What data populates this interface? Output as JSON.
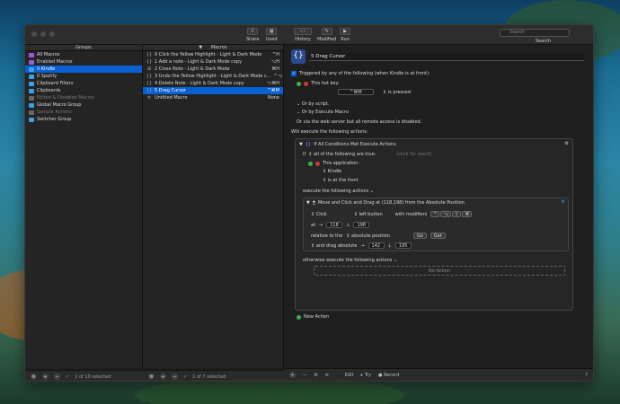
{
  "toolbar": {
    "share": "Share",
    "used": "Used",
    "history": "History",
    "modified": "Modified",
    "run": "Run",
    "search_placeholder": "Search",
    "search_label": "Search"
  },
  "groups": {
    "header": "Groups",
    "items": [
      {
        "label": "All Macros",
        "color": "#9b59e0",
        "state": "normal"
      },
      {
        "label": "Enabled Macros",
        "color": "#9b59e0",
        "state": "normal"
      },
      {
        "label": "0 Kindle",
        "color": "#3aa0e8",
        "state": "selected"
      },
      {
        "label": "0 Spotify",
        "color": "#3aa0e8",
        "state": "normal"
      },
      {
        "label": "Clipboard Filters",
        "color": "#3aa0e8",
        "state": "normal"
      },
      {
        "label": "Clipboards",
        "color": "#3aa0e8",
        "state": "normal"
      },
      {
        "label": "Edited & Disabled Macros",
        "color": "#666666",
        "state": "dim"
      },
      {
        "label": "Global Macro Group",
        "color": "#3aa0e8",
        "state": "normal"
      },
      {
        "label": "Sample Actions",
        "color": "#666666",
        "state": "dim"
      },
      {
        "label": "Switcher Group",
        "color": "#3aa0e8",
        "state": "normal"
      }
    ],
    "footer_count": "1 of 10 selected"
  },
  "macros": {
    "header": "Macros",
    "items": [
      {
        "label": "0 Click the Yellow Highlight - Light & Dark Mode",
        "hotkey": "^H",
        "icon": "{}",
        "state": "normal"
      },
      {
        "label": "1 Add a note - Light & Dark Mode copy",
        "hotkey": "⌥H",
        "icon": "{}",
        "state": "normal"
      },
      {
        "label": "2 Close Note - Light & Dark Mode",
        "hotkey": "⌘H",
        "icon": "⊞",
        "state": "normal"
      },
      {
        "label": "3 Undo the Yellow Highlight - Light & Dark Mode c...",
        "hotkey": "^⌥⇧⌘H",
        "icon": "{}",
        "state": "normal"
      },
      {
        "label": "4 Delete Note - Light & Dark Mode copy",
        "hotkey": "⌥⌘H",
        "icon": "{}",
        "state": "normal"
      },
      {
        "label": "5 Drag Cursor",
        "hotkey": "^⌘M",
        "icon": "{}",
        "state": "selected"
      },
      {
        "label": "Untitled Macro",
        "hotkey": "None",
        "icon": "✲",
        "state": "normal"
      }
    ],
    "footer_count": "1 of 7 selected"
  },
  "editor": {
    "macro_name": "5 Drag Cursor",
    "trigger_heading": "Triggered by any of the following (when Kindle is at front):",
    "hotkey_label": "This hot key:",
    "hotkey_value": "^⌘M",
    "hotkey_mode": "is pressed",
    "or_by_script": "Or by script.",
    "or_by_execute": "Or by Execute Macro",
    "web_server_note": "Or via the web server but all remote access is disabled.",
    "will_execute": "Will execute the following actions:",
    "if_action": {
      "title": "If All Conditions Met Execute Actions",
      "cond_prefix": "If",
      "cond_all": "all of the following are true:",
      "click_hint": "(click for result)",
      "cond_app": "This application:",
      "app_name": "Kindle",
      "app_state": "is at the front",
      "then_label": "execute the following actions",
      "inner_action": {
        "title": "Move and Click and Drag at (118,198) from the Absolute Position",
        "click": "Click",
        "button": "left button",
        "modifiers_label": "with modifiers",
        "modifiers": [
          "^",
          "⌥",
          "⇧",
          "⌘"
        ],
        "at_label": "at",
        "x": "118",
        "y": "198",
        "relative_label": "relative to the",
        "relative_value": "absolute position",
        "go": "Go",
        "get": "Get",
        "drag_label": "and drag absolute",
        "drag_x": "142",
        "drag_y": "195"
      },
      "else_label": "otherwise execute the following actions",
      "no_action": "No Action"
    },
    "new_action": "New Action"
  },
  "editor_footer": {
    "edit": "Edit",
    "try": "Try",
    "record": "Record"
  }
}
